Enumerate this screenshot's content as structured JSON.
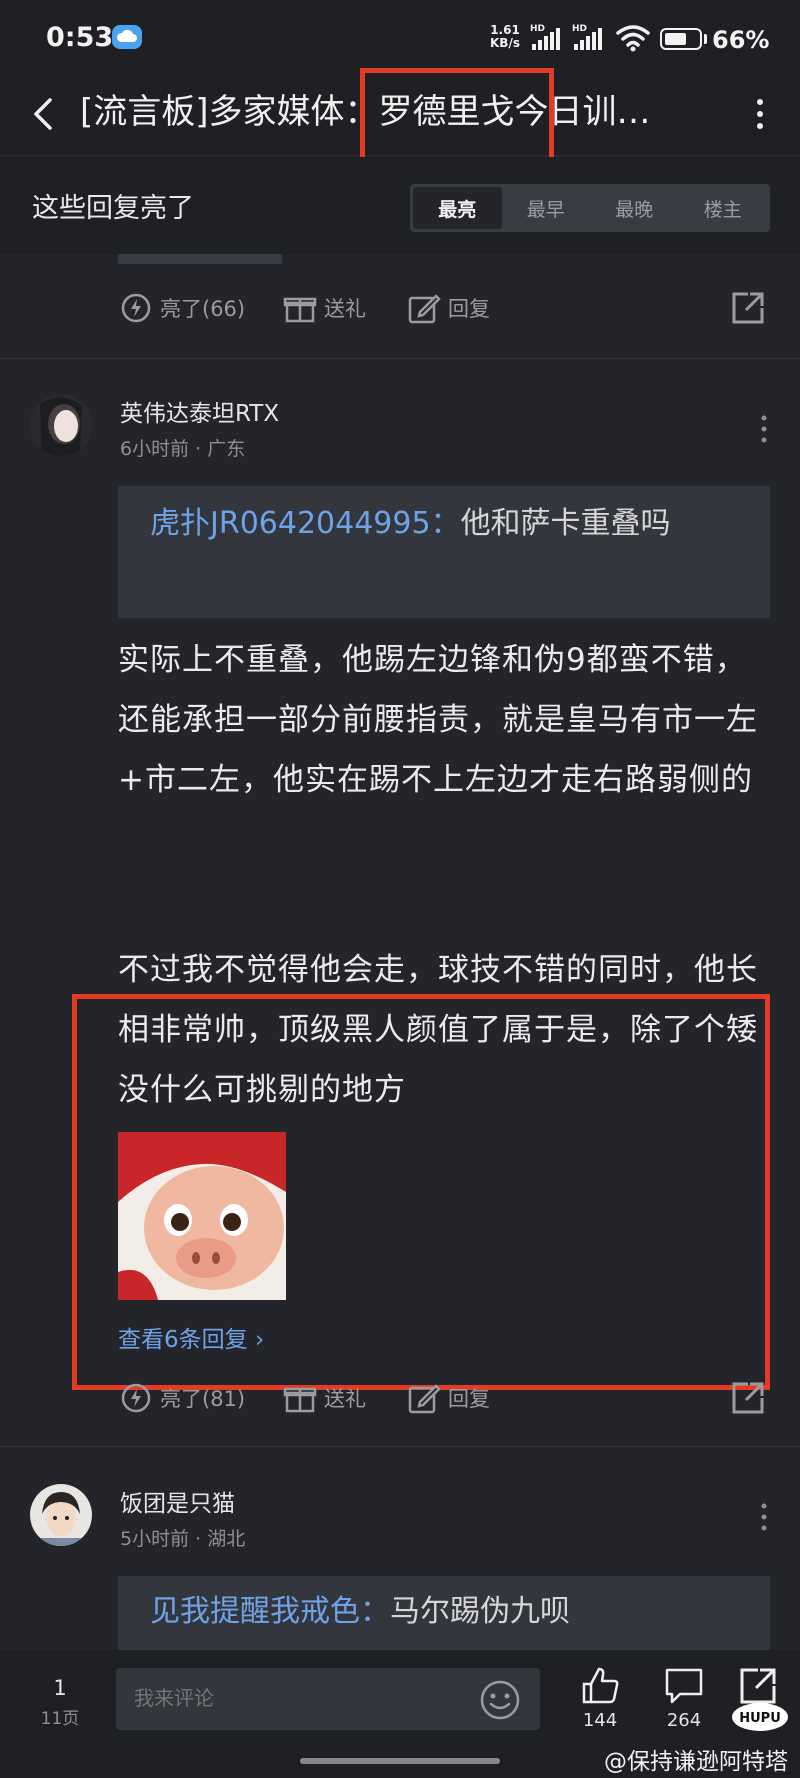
{
  "status": {
    "time": "0:53",
    "speed_top": "1.61",
    "speed_unit": "KB/s",
    "hd_label": "HD",
    "battery_text": "66%",
    "battery_level": 0.66
  },
  "header": {
    "title": "[流言板]多家媒体：罗德里戈今日训…"
  },
  "filter": {
    "heading": "这些回复亮了",
    "tabs": [
      {
        "label": "最亮",
        "active": true
      },
      {
        "label": "最早",
        "active": false
      },
      {
        "label": "最晚",
        "active": false
      },
      {
        "label": "楼主",
        "active": false
      }
    ]
  },
  "first_actions": {
    "like": "亮了(66)",
    "gift": "送礼",
    "reply": "回复"
  },
  "comment1": {
    "username": "英伟达泰坦RTX",
    "meta": "6小时前 · 广东",
    "quote_name": "虎扑JR0642044995：",
    "quote_text": "他和萨卡重叠吗",
    "body_p1": "实际上不重叠，他踢左边锋和伪9都蛮不错，还能承担一部分前腰指责，就是皇马有市一左+市二左，他实在踢不上左边才走右路弱侧的",
    "body_p2": "不过我不觉得他会走，球技不错的同时，他长相非常帅，顶级黑人颜值了属于是，除了个矮没什么可挑剔的地方",
    "replies_link": "查看6条回复 ›",
    "like": "亮了(81)",
    "gift": "送礼",
    "reply": "回复"
  },
  "comment2": {
    "username": "饭团是只猫",
    "meta": "5小时前 · 湖北",
    "quote_name": "见我提醒我戒色：",
    "quote_text": "马尔踢伪九呗"
  },
  "bottom": {
    "page_num": "1",
    "page_total": "11页",
    "input_placeholder": "我来评论",
    "likes_count": "144",
    "comments_count": "264",
    "watermark": "@保持谦逊阿特塔",
    "logo_text": "HUPU"
  },
  "colors": {
    "accent_blue": "#6fa3e8",
    "highlight_red": "#e33b26",
    "background": "#24252a"
  }
}
